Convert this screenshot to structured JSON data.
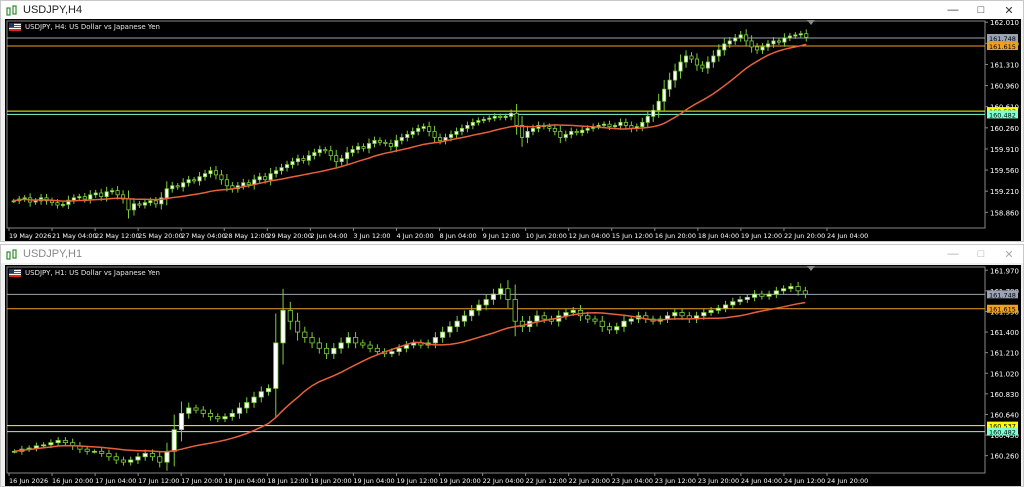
{
  "windows": [
    {
      "title": "USDJPY,H4",
      "symbol_label": "USDJPY, H4:  US Dollar vs Japanese Yen",
      "controls": {
        "minimize": "—",
        "maximize": "□",
        "close": "✕"
      },
      "chart_data": {
        "type": "candlestick",
        "title": "USDJPY, H4:  US Dollar vs Japanese Yen",
        "x_tick_labels": [
          "19 May 2026",
          "21 May 04:00",
          "22 May 12:00",
          "25 May 20:00",
          "27 May 04:00",
          "28 May 12:00",
          "29 May 20:00",
          "2 Jun 04:00",
          "3 Jun 12:00",
          "4 Jun 20:00",
          "8 Jun 04:00",
          "9 Jun 12:00",
          "10 Jun 20:00",
          "12 Jun 04:00",
          "15 Jun 12:00",
          "16 Jun 20:00",
          "18 Jun 04:00",
          "19 Jun 12:00",
          "22 Jun 20:00",
          "24 Jun 04:00"
        ],
        "y_tick_labels": [
          "162.010",
          "161.660",
          "161.310",
          "160.960",
          "160.610",
          "160.260",
          "159.910",
          "159.560",
          "159.210",
          "158.860"
        ],
        "ylim": [
          158.6,
          162.03
        ],
        "y_ticks": [
          162.01,
          161.66,
          161.31,
          160.96,
          160.61,
          160.26,
          159.91,
          159.56,
          159.21,
          158.86
        ],
        "closes": [
          159.05,
          159.08,
          159.1,
          159.03,
          159.05,
          159.1,
          159.05,
          159.02,
          158.98,
          158.99,
          159.06,
          159.1,
          159.12,
          159.08,
          159.15,
          159.18,
          159.12,
          159.2,
          159.22,
          159.15,
          159.08,
          158.9,
          159.0,
          158.98,
          159.02,
          159.05,
          159.0,
          159.1,
          159.25,
          159.3,
          159.28,
          159.35,
          159.4,
          159.38,
          159.45,
          159.5,
          159.55,
          159.48,
          159.4,
          159.3,
          159.25,
          159.3,
          159.35,
          159.32,
          159.4,
          159.45,
          159.4,
          159.5,
          159.55,
          159.6,
          159.65,
          159.7,
          159.75,
          159.72,
          159.8,
          159.85,
          159.9,
          159.88,
          159.8,
          159.7,
          159.75,
          159.85,
          159.9,
          159.95,
          159.92,
          160.0,
          160.05,
          160.02,
          160.0,
          159.95,
          160.05,
          160.1,
          160.15,
          160.2,
          160.25,
          160.28,
          160.2,
          160.1,
          160.05,
          160.1,
          160.15,
          160.2,
          160.25,
          160.3,
          160.35,
          160.38,
          160.4,
          160.42,
          160.45,
          160.43,
          160.45,
          160.5,
          160.3,
          160.1,
          160.2,
          160.25,
          160.3,
          160.28,
          160.25,
          160.2,
          160.1,
          160.15,
          160.2,
          160.18,
          160.22,
          160.25,
          160.28,
          160.3,
          160.32,
          160.28,
          160.3,
          160.35,
          160.3,
          160.25,
          160.28,
          160.35,
          160.45,
          160.55,
          160.7,
          160.9,
          161.05,
          161.2,
          161.35,
          161.45,
          161.4,
          161.3,
          161.25,
          161.35,
          161.45,
          161.55,
          161.65,
          161.7,
          161.75,
          161.8,
          161.7,
          161.6,
          161.55,
          161.6,
          161.65,
          161.7,
          161.68,
          161.75,
          161.78,
          161.8,
          161.82,
          161.76
        ],
        "moving_average_period": 20,
        "horizontal_lines": [
          {
            "value": 161.748,
            "color": "#9aa4b4",
            "label": "161.748"
          },
          {
            "value": 161.615,
            "color": "#f0a020",
            "label": "161.615"
          },
          {
            "value": 160.537,
            "color": "#ffff00",
            "label": "160.537"
          },
          {
            "value": 160.482,
            "color": "#7fffd4",
            "label": "160.482"
          }
        ]
      }
    },
    {
      "title": "USDJPY,H1",
      "symbol_label": "USDJPY, H1:  US Dollar vs Japanese Yen",
      "controls": {
        "minimize": "—",
        "maximize": "□",
        "close": "✕"
      },
      "chart_data": {
        "type": "candlestick",
        "title": "USDJPY, H1:  US Dollar vs Japanese Yen",
        "x_tick_labels": [
          "16 Jun 2026",
          "16 Jun 20:00",
          "17 Jun 04:00",
          "17 Jun 12:00",
          "17 Jun 20:00",
          "18 Jun 04:00",
          "18 Jun 12:00",
          "18 Jun 20:00",
          "19 Jun 04:00",
          "19 Jun 12:00",
          "19 Jun 20:00",
          "22 Jun 04:00",
          "22 Jun 12:00",
          "22 Jun 20:00",
          "23 Jun 04:00",
          "23 Jun 12:00",
          "23 Jun 20:00",
          "24 Jun 04:00",
          "24 Jun 12:00",
          "24 Jun 20:00"
        ],
        "y_tick_labels": [
          "161.970",
          "161.780",
          "161.590",
          "161.400",
          "161.210",
          "161.020",
          "160.830",
          "160.640",
          "160.450",
          "160.260"
        ],
        "ylim": [
          160.1,
          162.0
        ],
        "y_ticks": [
          161.97,
          161.78,
          161.59,
          161.4,
          161.21,
          161.02,
          160.83,
          160.64,
          160.45,
          160.26
        ],
        "closes": [
          160.3,
          160.32,
          160.33,
          160.35,
          160.36,
          160.38,
          160.4,
          160.38,
          160.35,
          160.32,
          160.3,
          160.3,
          160.28,
          160.25,
          160.22,
          160.2,
          160.22,
          160.25,
          160.28,
          160.25,
          160.2,
          160.3,
          160.5,
          160.65,
          160.7,
          160.68,
          160.65,
          160.62,
          160.6,
          160.62,
          160.65,
          160.7,
          160.75,
          160.8,
          160.85,
          160.88,
          161.3,
          161.6,
          161.5,
          161.4,
          161.35,
          161.3,
          161.25,
          161.2,
          161.25,
          161.3,
          161.35,
          161.3,
          161.28,
          161.25,
          161.22,
          161.2,
          161.22,
          161.25,
          161.28,
          161.3,
          161.28,
          161.3,
          161.35,
          161.4,
          161.45,
          161.5,
          161.55,
          161.6,
          161.65,
          161.7,
          161.75,
          161.8,
          161.7,
          161.5,
          161.45,
          161.5,
          161.55,
          161.52,
          161.5,
          161.55,
          161.58,
          161.6,
          161.55,
          161.52,
          161.5,
          161.45,
          161.42,
          161.45,
          161.5,
          161.52,
          161.55,
          161.52,
          161.5,
          161.52,
          161.55,
          161.58,
          161.55,
          161.52,
          161.55,
          161.58,
          161.6,
          161.62,
          161.65,
          161.68,
          161.7,
          161.72,
          161.75,
          161.73,
          161.75,
          161.78,
          161.8,
          161.82,
          161.78,
          161.75
        ],
        "moving_average_period": 20,
        "horizontal_lines": [
          {
            "value": 161.748,
            "color": "#9aa4b4",
            "label": "161.748"
          },
          {
            "value": 161.615,
            "color": "#f0a020",
            "label": "161.615"
          },
          {
            "value": 160.537,
            "color": "#ffff00",
            "label": "160.537"
          },
          {
            "value": 160.482,
            "color": "#7fffd4",
            "label": "160.482"
          }
        ]
      }
    }
  ],
  "colors": {
    "chart_bg": "#000000",
    "candle_bull": "#ffffff",
    "candle_bear": "#000000",
    "candle_outline": "#7ccd3c",
    "moving_average": "#e8603c",
    "axis_text": "#ffffff"
  },
  "icons": {
    "window_icon": "chart-window-icon",
    "flag": "us-flag-icon"
  }
}
